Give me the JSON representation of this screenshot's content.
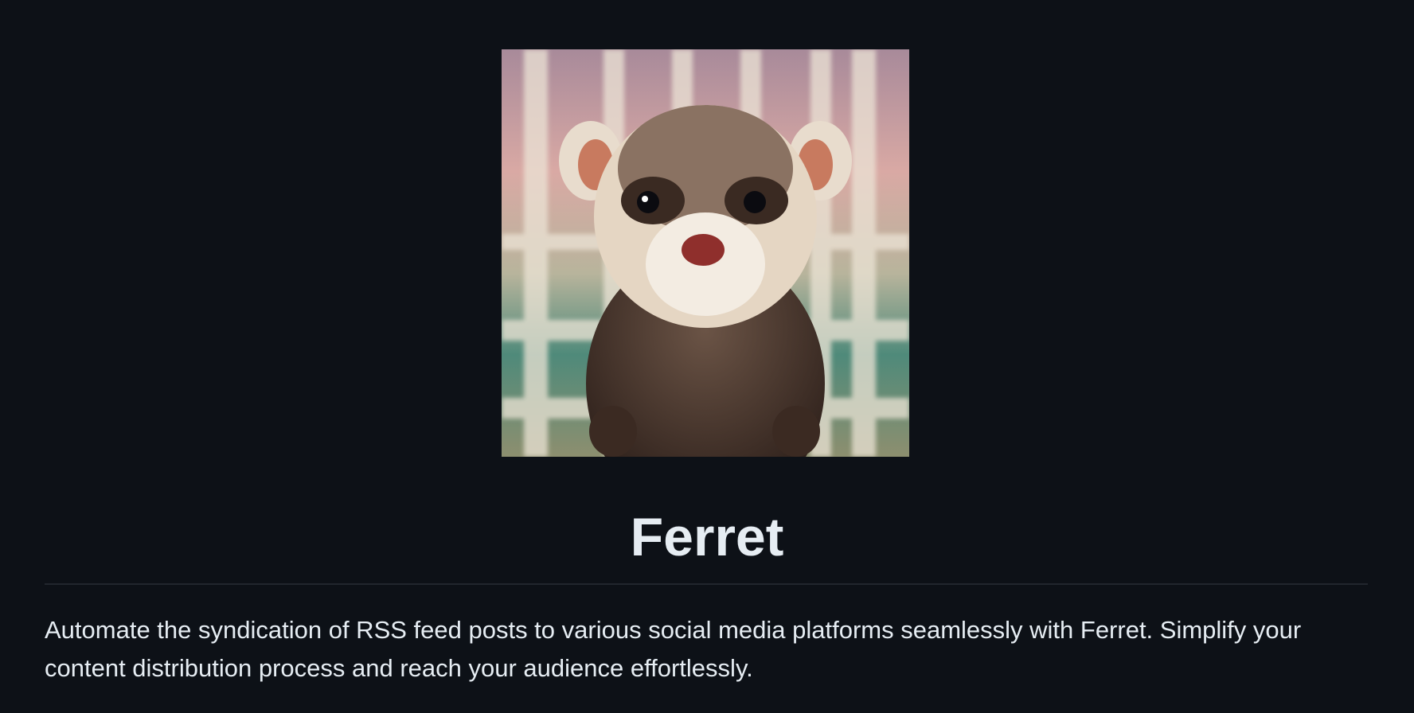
{
  "readme": {
    "logo_alt": "Ferret mascot",
    "title": "Ferret",
    "description": "Automate the syndication of RSS feed posts to various social media platforms seamlessly with Ferret. Simplify your content distribution process and reach your audience effortlessly."
  }
}
